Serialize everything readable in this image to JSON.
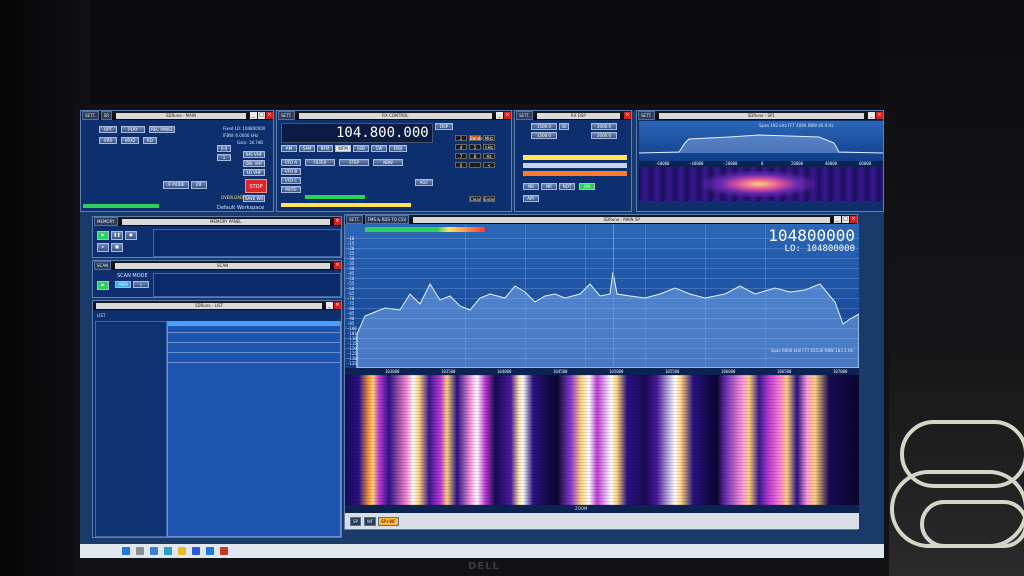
{
  "display": {
    "main_frequency": "104800000",
    "lo_label": "LO: 104800000",
    "source_main_freq": "104.800.000",
    "stop_label": "STOP",
    "workspace_label": "Default Workspace",
    "clear_label": "Clear",
    "enter_label": "Enter"
  },
  "windows": {
    "source": {
      "title": "SDRuno - MAIN",
      "sr_label": "SR",
      "sett_label": "SETT."
    },
    "rx_control": {
      "title": "RX CONTROL",
      "sett_label": "SETT."
    },
    "spectrum_small": {
      "title": "SDRuno - SP1",
      "sett_label": "SETT."
    },
    "rx_dsp": {
      "title": "RX DSP",
      "sett_label": "SETT."
    },
    "main_sp": {
      "title": "SDRuno - MAIN SP",
      "tab_label": "FMS & RDS TO CSV",
      "sett_label": "SETT."
    },
    "memory": {
      "title": "MEMORY PANEL",
      "label": "MEMORY"
    },
    "scan": {
      "title": "SCAN",
      "label": "SCAN MODE"
    },
    "list": {
      "title": "SDRuno - LIST",
      "label": "LIST"
    }
  },
  "spectrum": {
    "db_ticks": [
      "-10",
      "-15",
      "-20",
      "-25",
      "-30",
      "-35",
      "-40",
      "-45",
      "-50",
      "-55",
      "-60",
      "-65",
      "-70",
      "-75",
      "-80",
      "-85",
      "-90",
      "-95",
      "-100",
      "-105",
      "-110",
      "-115",
      "-120",
      "-125",
      "-130",
      "-135"
    ],
    "freq_ticks": [
      "103000",
      "103500",
      "104000",
      "104500",
      "105000",
      "105500",
      "106000",
      "106500",
      "107000"
    ],
    "status": "Span 6000 kHz  FFT 65536  RBW 183.1 Hz",
    "zoom_label": "ZOOM"
  },
  "small_spectrum": {
    "ticks": [
      "-60000",
      "-40000",
      "-20000",
      "0",
      "20000",
      "40000",
      "60000"
    ],
    "status": "Span 192 kHz  FFT 4096  RBW 46.9 Hz"
  },
  "colors": {
    "panel": "#0d2f6e",
    "spectrum_top": "#2c67b8",
    "trace": "#e8f2ff",
    "waterfall_hot": "#ffd27a",
    "waterfall_mid": "#c03bd8",
    "stop": "#d8262a"
  },
  "taskbar": {
    "icons": [
      "windows-icon",
      "search-icon",
      "task-view-icon",
      "edge-icon",
      "explorer-icon",
      "store-icon",
      "mail-icon",
      "app-icon"
    ]
  }
}
